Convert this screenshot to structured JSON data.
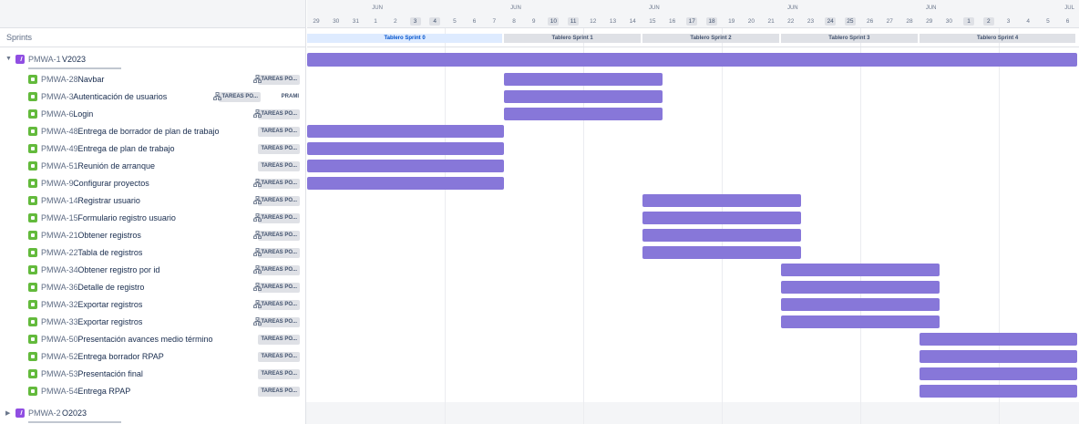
{
  "sidebar": {
    "sprints_label": "Sprints",
    "epics": [
      {
        "key": "PMWA-1",
        "name": "V2023",
        "expanded": true
      },
      {
        "key": "PMWA-2",
        "name": "O2023",
        "expanded": false
      }
    ],
    "issues": [
      {
        "key": "PMWA-28",
        "summary": "Navbar",
        "sprint": "TAREAS PO...",
        "has_children": true
      },
      {
        "key": "PMWA-3",
        "summary": "Autenticación de usuarios",
        "sprint": "TAREAS PO...",
        "assignee": "PRAMI",
        "has_children": true
      },
      {
        "key": "PMWA-6",
        "summary": "Login",
        "sprint": "TAREAS PO...",
        "has_children": true
      },
      {
        "key": "PMWA-48",
        "summary": "Entrega de borrador de plan de trabajo",
        "sprint": "TAREAS PO...",
        "has_children": false
      },
      {
        "key": "PMWA-49",
        "summary": "Entrega de plan de trabajo",
        "sprint": "TAREAS PO...",
        "has_children": false
      },
      {
        "key": "PMWA-51",
        "summary": "Reunión de arranque",
        "sprint": "TAREAS PO...",
        "has_children": false
      },
      {
        "key": "PMWA-9",
        "summary": "Configurar proyectos",
        "sprint": "TAREAS PO...",
        "has_children": true
      },
      {
        "key": "PMWA-14",
        "summary": "Registrar usuario",
        "sprint": "TAREAS PO...",
        "has_children": true
      },
      {
        "key": "PMWA-15",
        "summary": "Formulario registro usuario",
        "sprint": "TAREAS PO...",
        "has_children": true
      },
      {
        "key": "PMWA-21",
        "summary": "Obtener registros",
        "sprint": "TAREAS PO...",
        "has_children": true
      },
      {
        "key": "PMWA-22",
        "summary": "Tabla de registros",
        "sprint": "TAREAS PO...",
        "has_children": true
      },
      {
        "key": "PMWA-34",
        "summary": "Obtener registro por id",
        "sprint": "TAREAS PO...",
        "has_children": true
      },
      {
        "key": "PMWA-36",
        "summary": "Detalle de registro",
        "sprint": "TAREAS PO...",
        "has_children": true
      },
      {
        "key": "PMWA-32",
        "summary": "Exportar registros",
        "sprint": "TAREAS PO...",
        "has_children": true
      },
      {
        "key": "PMWA-33",
        "summary": "Exportar registros",
        "sprint": "TAREAS PO...",
        "has_children": true
      },
      {
        "key": "PMWA-50",
        "summary": "Presentación avances medio término",
        "sprint": "TAREAS PO...",
        "has_children": false
      },
      {
        "key": "PMWA-52",
        "summary": "Entrega borrador RPAP",
        "sprint": "TAREAS PO...",
        "has_children": false
      },
      {
        "key": "PMWA-53",
        "summary": "Presentación final",
        "sprint": "TAREAS PO...",
        "has_children": false
      },
      {
        "key": "PMWA-54",
        "summary": "Entrega RPAP",
        "sprint": "TAREAS PO...",
        "has_children": false
      }
    ]
  },
  "timeline": {
    "months": [
      {
        "label": "JUN",
        "day_index": 3
      },
      {
        "label": "JUN",
        "day_index": 10
      },
      {
        "label": "JUN",
        "day_index": 17
      },
      {
        "label": "JUN",
        "day_index": 24
      },
      {
        "label": "JUN",
        "day_index": 31
      },
      {
        "label": "JUL",
        "day_index": 38
      }
    ],
    "days": [
      {
        "d": "29"
      },
      {
        "d": "30"
      },
      {
        "d": "31"
      },
      {
        "d": "1"
      },
      {
        "d": "2"
      },
      {
        "d": "3",
        "we": true
      },
      {
        "d": "4",
        "we": true
      },
      {
        "d": "5"
      },
      {
        "d": "6"
      },
      {
        "d": "7"
      },
      {
        "d": "8"
      },
      {
        "d": "9"
      },
      {
        "d": "10",
        "we": true
      },
      {
        "d": "11",
        "we": true
      },
      {
        "d": "12"
      },
      {
        "d": "13"
      },
      {
        "d": "14"
      },
      {
        "d": "15"
      },
      {
        "d": "16"
      },
      {
        "d": "17",
        "we": true
      },
      {
        "d": "18",
        "we": true
      },
      {
        "d": "19"
      },
      {
        "d": "20"
      },
      {
        "d": "21"
      },
      {
        "d": "22"
      },
      {
        "d": "23"
      },
      {
        "d": "24",
        "we": true
      },
      {
        "d": "25",
        "we": true
      },
      {
        "d": "26"
      },
      {
        "d": "27"
      },
      {
        "d": "28"
      },
      {
        "d": "29"
      },
      {
        "d": "30"
      },
      {
        "d": "1",
        "we": true
      },
      {
        "d": "2",
        "we": true
      },
      {
        "d": "3"
      },
      {
        "d": "4"
      },
      {
        "d": "5"
      },
      {
        "d": "6"
      }
    ],
    "sprints": [
      {
        "label": "Tablero Sprint 0",
        "start": 0,
        "end": 10,
        "active": true
      },
      {
        "label": "Tablero Sprint 1",
        "start": 10,
        "end": 17
      },
      {
        "label": "Tablero Sprint 2",
        "start": 17,
        "end": 24
      },
      {
        "label": "Tablero Sprint 3",
        "start": 24,
        "end": 31
      },
      {
        "label": "Tablero Sprint 4",
        "start": 31,
        "end": 39
      }
    ],
    "epic_bar": {
      "start": 0,
      "end": 39
    },
    "bars": [
      {
        "start": 10,
        "end": 18
      },
      {
        "start": 10,
        "end": 18
      },
      {
        "start": 10,
        "end": 18
      },
      {
        "start": 0,
        "end": 10
      },
      {
        "start": 0,
        "end": 10
      },
      {
        "start": 0,
        "end": 10
      },
      {
        "start": 0,
        "end": 10
      },
      {
        "start": 17,
        "end": 25
      },
      {
        "start": 17,
        "end": 25
      },
      {
        "start": 17,
        "end": 25
      },
      {
        "start": 17,
        "end": 25
      },
      {
        "start": 24,
        "end": 32
      },
      {
        "start": 24,
        "end": 32
      },
      {
        "start": 24,
        "end": 32
      },
      {
        "start": 24,
        "end": 32
      },
      {
        "start": 31,
        "end": 39
      },
      {
        "start": 31,
        "end": 39
      },
      {
        "start": 31,
        "end": 39
      },
      {
        "start": 31,
        "end": 39
      }
    ]
  },
  "colors": {
    "bar": "#8777d9",
    "epic_icon": "#904ee2",
    "story_icon": "#63ba3c",
    "sprint_active": "#deebff"
  }
}
